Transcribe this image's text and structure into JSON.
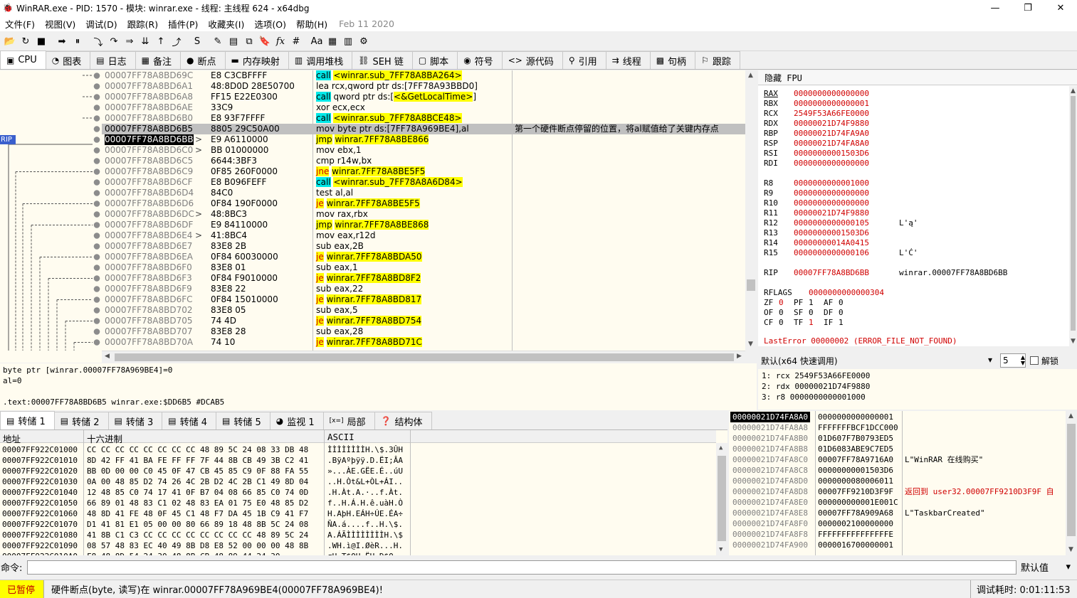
{
  "window": {
    "title": "WinRAR.exe - PID: 1570 - 模块: winrar.exe - 线程: 主线程 624 - x64dbg",
    "min_glyph": "—",
    "max_glyph": "❐",
    "close_glyph": "✕",
    "app_glyph": "🐞"
  },
  "menu": {
    "items": [
      "文件(F)",
      "视图(V)",
      "调试(D)",
      "跟踪(R)",
      "插件(P)",
      "收藏夹(I)",
      "选项(O)",
      "帮助(H)"
    ],
    "date": "Feb 11 2020"
  },
  "toolbar": {
    "icons": [
      "open-icon",
      "restart-icon",
      "stop-icon",
      "run-icon",
      "pause-icon",
      "step-into-icon",
      "step-over-icon",
      "trace-into-icon",
      "trace-over-icon",
      "execute-till-return-icon",
      "run-to-user-code-icon",
      "scylla-icon",
      "patch-icon",
      "comment-icon",
      "label-icon",
      "bookmark-icon",
      "function-icon",
      "hash-icon",
      "strings-icon",
      "calculator-icon",
      "cheat-sheet-icon",
      "about-icon"
    ],
    "glyphs": [
      "📂",
      "↻",
      "■",
      "➡",
      "⏸",
      "⤵",
      "↷",
      "⇒",
      "⇊",
      "↑",
      "⤴",
      "S",
      "✎",
      "▤",
      "⧉",
      "🔖",
      "fx",
      "#",
      "Aa",
      "▦",
      "▥",
      "⚙"
    ],
    "fx_label": "fx",
    "hash_label": "#"
  },
  "tabs": [
    {
      "label": "CPU",
      "icon": "cpu-icon",
      "glyph": "▣",
      "active": true
    },
    {
      "label": "图表",
      "icon": "graph-icon",
      "glyph": "◔"
    },
    {
      "label": "日志",
      "icon": "log-icon",
      "glyph": "▤"
    },
    {
      "label": "备注",
      "icon": "notes-icon",
      "glyph": "▦"
    },
    {
      "label": "断点",
      "icon": "breakpoint-icon",
      "glyph": "●"
    },
    {
      "label": "内存映射",
      "icon": "memory-map-icon",
      "glyph": "▬"
    },
    {
      "label": "调用堆栈",
      "icon": "call-stack-icon",
      "glyph": "▥"
    },
    {
      "label": "SEH 链",
      "icon": "seh-icon",
      "glyph": "⛓"
    },
    {
      "label": "脚本",
      "icon": "script-icon",
      "glyph": "▢"
    },
    {
      "label": "符号",
      "icon": "symbols-icon",
      "glyph": "◉"
    },
    {
      "label": "源代码",
      "icon": "source-icon",
      "glyph": "<>"
    },
    {
      "label": "引用",
      "icon": "references-icon",
      "glyph": "⚲"
    },
    {
      "label": "线程",
      "icon": "threads-icon",
      "glyph": "⇉"
    },
    {
      "label": "句柄",
      "icon": "handles-icon",
      "glyph": "▩"
    },
    {
      "label": "跟踪",
      "icon": "trace-icon",
      "glyph": "⚐"
    }
  ],
  "disasm": {
    "rip_label": "RIP",
    "rows": [
      {
        "addr": "00007FF78A8BD69C",
        "bytes": "E8 C3CBFFFF",
        "instr": "call <winrar.sub_7FF78A8BA264>",
        "kind": "call",
        "mark": ""
      },
      {
        "addr": "00007FF78A8BD6A1",
        "bytes": "48:8D0D 28E50700",
        "instr": "lea rcx,qword ptr ds:[7FF78A93BBD0]",
        "kind": "",
        "mark": ""
      },
      {
        "addr": "00007FF78A8BD6A8",
        "bytes": "FF15 E22E0300",
        "instr": "call qword ptr ds:[<&GetLocalTime>]",
        "kind": "call",
        "mark": ""
      },
      {
        "addr": "00007FF78A8BD6AE",
        "bytes": "33C9",
        "instr": "xor ecx,ecx",
        "kind": "",
        "mark": ""
      },
      {
        "addr": "00007FF78A8BD6B0",
        "bytes": "E8 93F7FFFF",
        "instr": "call <winrar.sub_7FF78A8BCE48>",
        "kind": "call",
        "mark": ""
      },
      {
        "addr": "00007FF78A8BD6B5",
        "bytes": "8805 29C50A00",
        "instr": "mov byte ptr ds:[7FF78A969BE4],al",
        "kind": "",
        "mark": "",
        "comment": "第一个硬件断点停留的位置，将al赋值给了关键内存点",
        "selected": true
      },
      {
        "addr": "00007FF78A8BD6BB",
        "bytes": "E9 A6110000",
        "instr": "jmp winrar.7FF78A8BE866",
        "kind": "jmp",
        "mark": ">",
        "rip": true
      },
      {
        "addr": "00007FF78A8BD6C0",
        "bytes": "BB 01000000",
        "instr": "mov ebx,1",
        "kind": "",
        "mark": ">"
      },
      {
        "addr": "00007FF78A8BD6C5",
        "bytes": "6644:3BF3",
        "instr": "cmp r14w,bx",
        "kind": "",
        "mark": ""
      },
      {
        "addr": "00007FF78A8BD6C9",
        "bytes": "0F85 260F0000",
        "instr": "jne winrar.7FF78A8BE5F5",
        "kind": "jcc",
        "mark": ""
      },
      {
        "addr": "00007FF78A8BD6CF",
        "bytes": "E8 B096FEFF",
        "instr": "call <winrar.sub_7FF78A8A6D84>",
        "kind": "call",
        "mark": ""
      },
      {
        "addr": "00007FF78A8BD6D4",
        "bytes": "84C0",
        "instr": "test al,al",
        "kind": "",
        "mark": ""
      },
      {
        "addr": "00007FF78A8BD6D6",
        "bytes": "0F84 190F0000",
        "instr": "je winrar.7FF78A8BE5F5",
        "kind": "jcc",
        "mark": ""
      },
      {
        "addr": "00007FF78A8BD6DC",
        "bytes": "48:8BC3",
        "instr": "mov rax,rbx",
        "kind": "",
        "mark": ">"
      },
      {
        "addr": "00007FF78A8BD6DF",
        "bytes": "E9 84110000",
        "instr": "jmp winrar.7FF78A8BE868",
        "kind": "jmp",
        "mark": ""
      },
      {
        "addr": "00007FF78A8BD6E4",
        "bytes": "41:8BC4",
        "instr": "mov eax,r12d",
        "kind": "",
        "mark": ">"
      },
      {
        "addr": "00007FF78A8BD6E7",
        "bytes": "83E8 2B",
        "instr": "sub eax,2B",
        "kind": "",
        "mark": ""
      },
      {
        "addr": "00007FF78A8BD6EA",
        "bytes": "0F84 60030000",
        "instr": "je winrar.7FF78A8BDA50",
        "kind": "jcc",
        "mark": ""
      },
      {
        "addr": "00007FF78A8BD6F0",
        "bytes": "83E8 01",
        "instr": "sub eax,1",
        "kind": "",
        "mark": ""
      },
      {
        "addr": "00007FF78A8BD6F3",
        "bytes": "0F84 F9010000",
        "instr": "je winrar.7FF78A8BD8F2",
        "kind": "jcc",
        "mark": ""
      },
      {
        "addr": "00007FF78A8BD6F9",
        "bytes": "83E8 22",
        "instr": "sub eax,22",
        "kind": "",
        "mark": ""
      },
      {
        "addr": "00007FF78A8BD6FC",
        "bytes": "0F84 15010000",
        "instr": "je winrar.7FF78A8BD817",
        "kind": "jcc",
        "mark": ""
      },
      {
        "addr": "00007FF78A8BD702",
        "bytes": "83E8 05",
        "instr": "sub eax,5",
        "kind": "",
        "mark": ""
      },
      {
        "addr": "00007FF78A8BD705",
        "bytes": "74 4D",
        "instr": "je winrar.7FF78A8BD754",
        "kind": "jcc",
        "mark": ""
      },
      {
        "addr": "00007FF78A8BD707",
        "bytes": "83E8 28",
        "instr": "sub eax,28",
        "kind": "",
        "mark": ""
      },
      {
        "addr": "00007FF78A8BD70A",
        "bytes": "74 10",
        "instr": "je winrar.7FF78A8BD71C",
        "kind": "jcc",
        "mark": ""
      }
    ]
  },
  "info": {
    "line1": "byte ptr [winrar.00007FF78A969BE4]=0",
    "line2": "al=0",
    "line3": "",
    "line4": ".text:00007FF78A8BD6B5 winrar.exe:$DD6B5 #DCAB5"
  },
  "registers": {
    "header": "隐藏 FPU",
    "gp": [
      {
        "name": "RAX",
        "value": "0000000000000000",
        "changed": true,
        "underline": true
      },
      {
        "name": "RBX",
        "value": "0000000000000001",
        "changed": true
      },
      {
        "name": "RCX",
        "value": "2549F53A66FE0000",
        "changed": true
      },
      {
        "name": "RDX",
        "value": "00000021D74F9880",
        "changed": true
      },
      {
        "name": "RBP",
        "value": "00000021D74FA9A0",
        "changed": true
      },
      {
        "name": "RSP",
        "value": "00000021D74FA8A0",
        "changed": true
      },
      {
        "name": "RSI",
        "value": "00000000001503D6",
        "changed": true
      },
      {
        "name": "RDI",
        "value": "0000000000000000",
        "changed": true
      }
    ],
    "ext": [
      {
        "name": "R8",
        "value": "0000000000001000",
        "changed": true
      },
      {
        "name": "R9",
        "value": "0000000000000000",
        "changed": true
      },
      {
        "name": "R10",
        "value": "0000000000000000",
        "changed": true
      },
      {
        "name": "R11",
        "value": "00000021D74F9880",
        "changed": true
      },
      {
        "name": "R12",
        "value": "0000000000000105",
        "changed": true,
        "comment": "L'ą'"
      },
      {
        "name": "R13",
        "value": "00000000001503D6",
        "changed": true
      },
      {
        "name": "R14",
        "value": "00000000014A0415",
        "changed": true
      },
      {
        "name": "R15",
        "value": "0000000000000106",
        "changed": true,
        "comment": "L'Ć'"
      }
    ],
    "rip": {
      "name": "RIP",
      "value": "00007FF78A8BD6BB",
      "comment": "winrar.00007FF78A8BD6BB"
    },
    "rflags": {
      "name": "RFLAGS",
      "value": "0000000000000304"
    },
    "flags": [
      [
        {
          "n": "ZF",
          "v": "0",
          "c": true
        },
        {
          "n": "PF",
          "v": "1"
        },
        {
          "n": "AF",
          "v": "0"
        }
      ],
      [
        {
          "n": "OF",
          "v": "0"
        },
        {
          "n": "SF",
          "v": "0"
        },
        {
          "n": "DF",
          "v": "0"
        }
      ],
      [
        {
          "n": "CF",
          "v": "0"
        },
        {
          "n": "TF",
          "v": "1",
          "c": true
        },
        {
          "n": "IF",
          "v": "1"
        }
      ]
    ],
    "lasterror": "LastError  00000002 (ERROR_FILE_NOT_FOUND)"
  },
  "callconv": {
    "label": "默认(x64 快速调用)",
    "count": "5",
    "unlock_label": "解锁"
  },
  "args": [
    "1: rcx 2549F53A66FE0000",
    "2: rdx 00000021D74F9880",
    "3: r8 0000000000001000"
  ],
  "dump_tabs": [
    {
      "label": "转储 1",
      "icon": "dump-icon",
      "glyph": "▤",
      "active": true
    },
    {
      "label": "转储 2",
      "icon": "dump-icon",
      "glyph": "▤"
    },
    {
      "label": "转储 3",
      "icon": "dump-icon",
      "glyph": "▤"
    },
    {
      "label": "转储 4",
      "icon": "dump-icon",
      "glyph": "▤"
    },
    {
      "label": "转储 5",
      "icon": "dump-icon",
      "glyph": "▤"
    },
    {
      "label": "监视 1",
      "icon": "watch-icon",
      "glyph": "◕"
    },
    {
      "label": "局部",
      "icon": "locals-icon",
      "glyph": "[x=]"
    },
    {
      "label": "结构体",
      "icon": "struct-icon",
      "glyph": "❓"
    }
  ],
  "dump": {
    "col_addr": "地址",
    "col_hex": "十六进制",
    "col_ascii": "ASCII",
    "rows": [
      {
        "addr": "00007FF922C01000",
        "hex": "CC CC CC CC CC CC CC CC 48 89 5C 24 08 33 DB 48",
        "ascii": "ÌÌÌÌÌÌÌÌH.\\$.3ÛH"
      },
      {
        "addr": "00007FF922C01010",
        "hex": "8D 42 FF 41 BA FE FF FF 7F 44 8B CB 49 3B C2 41",
        "ascii": ".BÿAºþÿÿ.D.ËI;ÂA"
      },
      {
        "addr": "00007FF922C01020",
        "hex": "BB 0D 00 00 C0 45 0F 47 CB 45 85 C9 0F 88 FA 55",
        "ascii": "»...ÀE.GËE.É..úU"
      },
      {
        "addr": "00007FF922C01030",
        "hex": "0A 00 48 85 D2 74 26 4C 2B D2 4C 2B C1 49 8D 04",
        "ascii": "..H.Òt&L+ÒL+ÁI.."
      },
      {
        "addr": "00007FF922C01040",
        "hex": "12 48 85 C0 74 17 41 0F B7 04 08 66 85 C0 74 0D",
        "ascii": ".H.Àt.A.·..f.Àt."
      },
      {
        "addr": "00007FF922C01050",
        "hex": "66 89 01 48 83 C1 02 48 83 EA 01 75 E0 48 85 D2",
        "ascii": "f..H.Á.H.ê.uàH.Ò"
      },
      {
        "addr": "00007FF922C01060",
        "hex": "48 8D 41 FE 48 0F 45 C1 48 F7 DA 45 1B C9 41 F7",
        "ascii": "H.AþH.EÁH÷ÚE.ÉA÷"
      },
      {
        "addr": "00007FF922C01070",
        "hex": "D1 41 81 E1 05 00 00 80 66 89 18 48 8B 5C 24 08",
        "ascii": "ÑA.á....f..H.\\$."
      },
      {
        "addr": "00007FF922C01080",
        "hex": "41 8B C1 C3 CC CC CC CC CC CC CC CC 48 89 5C 24",
        "ascii": "A.ÁÃÌÌÌÌÌÌÌÌH.\\$"
      },
      {
        "addr": "00007FF922C01090",
        "hex": "08 57 48 83 EC 40 49 8B D8 E8 52 00 00 00 48 8B",
        "ascii": ".WH.ì@I.ØèR...H."
      },
      {
        "addr": "00007FF922C010A0",
        "hex": "F8 48 8D 54 24 30 48 8B CB 48 89 44 24 30",
        "ascii": "øH.T$0H.ËH.D$0"
      }
    ]
  },
  "stack": {
    "rows": [
      {
        "addr": "00000021D74FA8A0",
        "value": "0000000000000001",
        "comment": "",
        "current": true
      },
      {
        "addr": "00000021D74FA8A8",
        "value": "FFFFFFFBCF1DCC000",
        "comment": ""
      },
      {
        "addr": "00000021D74FA8B0",
        "value": "01D607F7B0793ED5",
        "comment": ""
      },
      {
        "addr": "00000021D74FA8B8",
        "value": "01D6083ABE9C7ED5",
        "comment": ""
      },
      {
        "addr": "00000021D74FA8C0",
        "value": "00007FF78A9716A0",
        "comment": "L\"WinRAR 在线购买\""
      },
      {
        "addr": "00000021D74FA8C8",
        "value": "00000000001503D6",
        "comment": ""
      },
      {
        "addr": "00000021D74FA8D0",
        "value": "0000000080006011",
        "comment": ""
      },
      {
        "addr": "00000021D74FA8D8",
        "value": "00007FF9210D3F9F",
        "comment": "返回到 user32.00007FF9210D3F9F 自",
        "red": true
      },
      {
        "addr": "00000021D74FA8E0",
        "value": "000000000001E001C",
        "comment": ""
      },
      {
        "addr": "00000021D74FA8E8",
        "value": "00007FF78A909A68",
        "comment": "L\"TaskbarCreated\""
      },
      {
        "addr": "00000021D74FA8F0",
        "value": "0000002100000000",
        "comment": ""
      },
      {
        "addr": "00000021D74FA8F8",
        "value": "FFFFFFFFFFFFFFFE",
        "comment": ""
      },
      {
        "addr": "00000021D74FA900",
        "value": "0000016700000001",
        "comment": ""
      }
    ]
  },
  "command": {
    "label": "命令:",
    "value": "",
    "default_label": "默认值"
  },
  "status": {
    "state": "已暂停",
    "message": "硬件断点(byte, 读写)在 winrar.00007FF78A969BE4(00007FF78A969BE4)!",
    "timer": "调试耗时:  0:01:11:53"
  },
  "colors": {
    "call_bg": "#00e8e8",
    "jmp_bg": "#ffff00",
    "changed_reg": "#d00000",
    "selected_row": "#c0c0c0",
    "rip_row": "#000000",
    "panel_bg": "#fffcf0"
  }
}
